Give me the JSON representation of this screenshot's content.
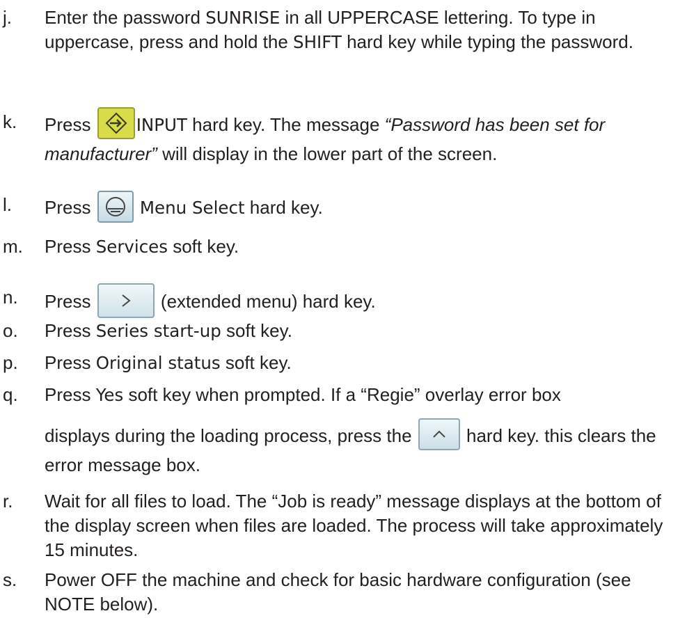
{
  "steps": [
    {
      "letter": "j.",
      "segments": [
        "Enter the password ",
        "SUNRISE",
        " in all UPPERCASE lettering. To type in uppercase, press and hold the ",
        "SHIFT",
        " hard key while typing the password."
      ]
    },
    {
      "letter": "k.",
      "segments": [
        "Press ",
        "INPUT",
        " hard key. The message ",
        "“Password has been set for manufacturer”",
        " will display in the lower part of the screen."
      ]
    },
    {
      "letter": "l.",
      "segments": [
        "Press ",
        "Menu Select",
        " hard key."
      ]
    },
    {
      "letter": "m.",
      "segments": [
        "Press ",
        "Services",
        " soft key."
      ]
    },
    {
      "letter": "n.",
      "segments": [
        "Press ",
        "(extended menu) hard key."
      ]
    },
    {
      "letter": "o.",
      "segments": [
        "Press ",
        "Series start-up",
        " soft key."
      ]
    },
    {
      "letter": "p.",
      "segments": [
        "Press ",
        "Original status",
        " soft key."
      ]
    },
    {
      "letter": "q.",
      "segments": [
        "Press ",
        "Yes",
        " soft key when prompted. If a “Regie” overlay error box",
        "displays during the loading process, press the ",
        "hard key. this clears the error message box."
      ]
    },
    {
      "letter": "r.",
      "segments": [
        "Wait for all files to load. The “Job is ready” message displays at the bottom of the display screen when files are loaded. The process will take approximately 15 minutes."
      ]
    },
    {
      "letter": "s.",
      "segments": [
        "Power OFF the machine and check for basic hardware configuration (see NOTE below)."
      ]
    }
  ],
  "icons": {
    "input_key": "arrow-into-box-icon",
    "menu_select_key": "menu-select-icon",
    "extended_menu_key": "chevron-right-icon",
    "up_key": "chevron-up-icon"
  },
  "colors": {
    "text": "#231f20",
    "input_key": "#d8dc48",
    "hard_key": "#d9e8ee"
  }
}
